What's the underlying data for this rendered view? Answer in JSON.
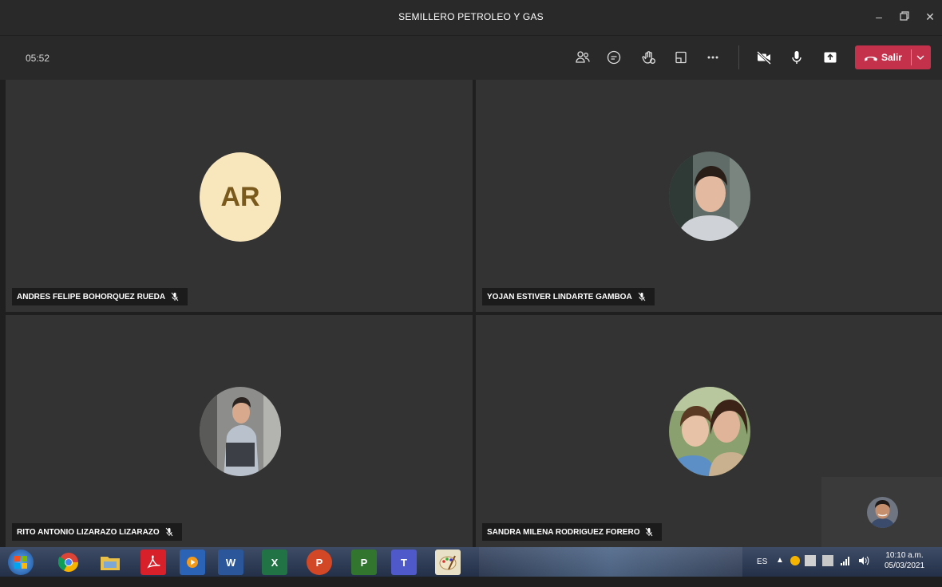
{
  "window": {
    "title": "SEMILLERO PETROLEO Y GAS"
  },
  "toolbar": {
    "timer": "05:52",
    "leave_label": "Salir"
  },
  "participants": [
    {
      "name": "ANDRES FELIPE BOHORQUEZ RUEDA",
      "initials": "AR",
      "muted": true
    },
    {
      "name": "YOJAN ESTIVER LINDARTE GAMBOA",
      "muted": true
    },
    {
      "name": "RITO ANTONIO LIZARAZO LIZARAZO",
      "muted": true
    },
    {
      "name": "SANDRA MILENA RODRIGUEZ FORERO",
      "muted": true
    }
  ],
  "taskbar": {
    "language": "ES",
    "time": "10:10 a.m.",
    "date": "05/03/2021",
    "apps": [
      "start",
      "chrome",
      "file-explorer",
      "acrobat",
      "media-player",
      "word",
      "excel",
      "powerpoint",
      "project",
      "teams",
      "paint"
    ]
  },
  "colors": {
    "leave": "#c4314b",
    "tile": "#333333",
    "initials_bg": "#f8e6bd"
  }
}
